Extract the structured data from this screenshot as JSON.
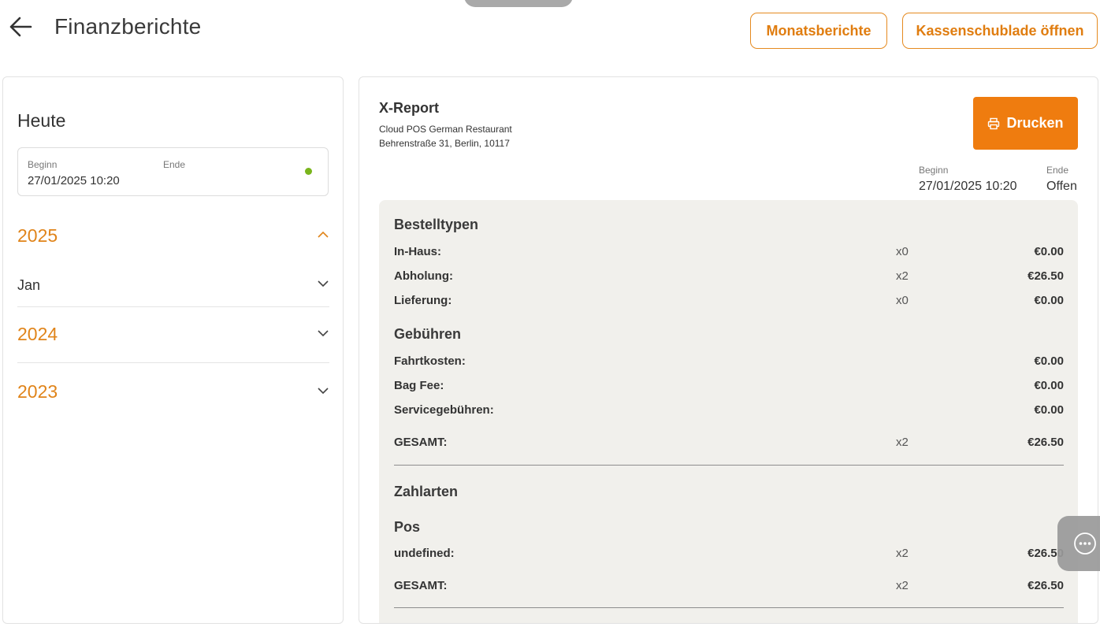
{
  "header": {
    "title": "Finanzberichte",
    "monthly_reports_label": "Monatsberichte",
    "open_drawer_label": "Kassenschublade öffnen"
  },
  "sidebar": {
    "today_label": "Heute",
    "range": {
      "begin_label": "Beginn",
      "end_label": "Ende",
      "begin_value": "27/01/2025 10:20",
      "status_color": "#79b51c"
    },
    "years": [
      {
        "label": "2025",
        "expanded": true,
        "months": [
          {
            "label": "Jan"
          }
        ]
      },
      {
        "label": "2024",
        "expanded": false
      },
      {
        "label": "2023",
        "expanded": false
      }
    ]
  },
  "report": {
    "title": "X-Report",
    "restaurant": "Cloud POS German Restaurant",
    "address": "Behrenstraße 31, Berlin, 10117",
    "print_label": "Drucken",
    "begin_label": "Beginn",
    "begin_value": "27/01/2025 10:20",
    "end_label": "Ende",
    "end_value": "Offen",
    "order_types": {
      "title": "Bestelltypen",
      "rows": [
        {
          "label": "In-Haus:",
          "qty": "x0",
          "amount": "€0.00"
        },
        {
          "label": "Abholung:",
          "qty": "x2",
          "amount": "€26.50"
        },
        {
          "label": "Lieferung:",
          "qty": "x0",
          "amount": "€0.00"
        }
      ]
    },
    "fees": {
      "title": "Gebühren",
      "rows": [
        {
          "label": "Fahrtkosten:",
          "amount": "€0.00"
        },
        {
          "label": "Bag Fee:",
          "amount": "€0.00"
        },
        {
          "label": "Servicegebühren:",
          "amount": "€0.00"
        }
      ]
    },
    "total_1": {
      "label": "GESAMT:",
      "qty": "x2",
      "amount": "€26.50"
    },
    "payments": {
      "title": "Zahlarten",
      "subtitle": "Pos",
      "rows": [
        {
          "label": "undefined:",
          "qty": "x2",
          "amount": "€26.50"
        }
      ]
    },
    "total_2": {
      "label": "GESAMT:",
      "qty": "x2",
      "amount": "€26.50"
    }
  },
  "colors": {
    "accent": "#ef7c0f",
    "year_text": "#e0841a",
    "report_bg": "#f1f0ec"
  },
  "icons": {
    "back": "arrow-left-icon",
    "chevron_up": "chevron-up-icon",
    "chevron_down": "chevron-down-icon",
    "print": "printer-icon",
    "more": "more-icon"
  }
}
